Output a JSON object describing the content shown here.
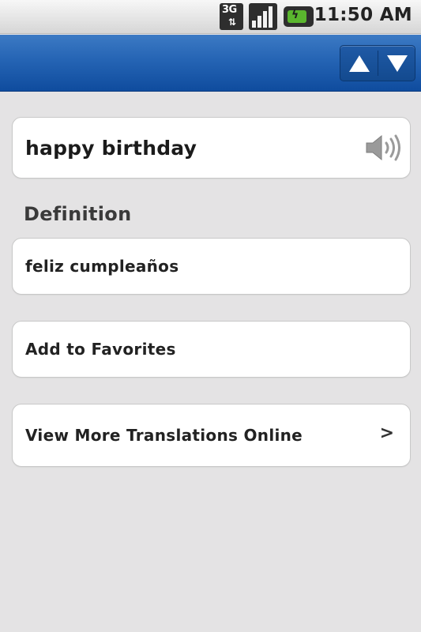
{
  "status_bar": {
    "network_label": "3G",
    "time": "11:50 AM",
    "icons": [
      "3g-data-icon",
      "signal-strength-icon",
      "battery-charging-icon"
    ]
  },
  "title_bar": {
    "nav_up_icon": "triangle-up-icon",
    "nav_down_icon": "triangle-down-icon"
  },
  "entry": {
    "phrase": "happy birthday",
    "speaker_icon": "speaker-icon"
  },
  "definition": {
    "heading": "Definition",
    "text": "feliz cumpleaños"
  },
  "actions": {
    "add_favorites": "Add to Favorites",
    "view_more": "View More Translations Online",
    "view_more_chevron": ">"
  },
  "colors": {
    "title_bar_blue": "#2564b4",
    "background": "#e4e3e4",
    "card": "#ffffff"
  }
}
